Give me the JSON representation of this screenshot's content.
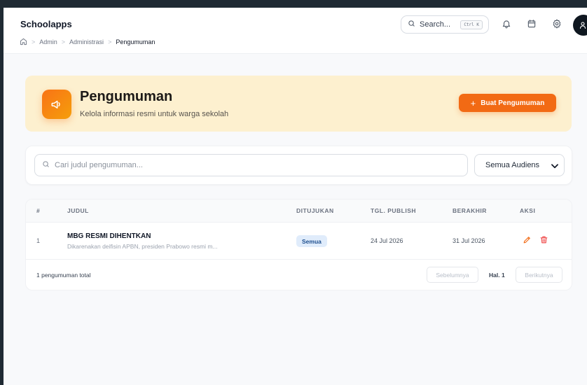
{
  "app": {
    "title": "Schoolapps"
  },
  "breadcrumb": {
    "items": [
      "Admin",
      "Administrasi",
      "Pengumuman"
    ]
  },
  "search": {
    "label": "Search...",
    "shortcut": "Ctrl K"
  },
  "banner": {
    "title": "Pengumuman",
    "subtitle": "Kelola informasi resmi untuk warga sekolah",
    "create_button": "Buat Pengumuman"
  },
  "filter": {
    "placeholder": "Cari judul pengumuman...",
    "audience_selected": "Semua Audiens"
  },
  "table": {
    "headers": {
      "num": "#",
      "title": "JUDUL",
      "target": "DITUJUKAN",
      "publish": "TGL. PUBLISH",
      "end": "BERAKHIR",
      "actions": "AKSI"
    },
    "rows": [
      {
        "num": "1",
        "title": "MBG RESMI DIHENTKAN",
        "desc": "Dikarenakan deifisin APBN, presiden Prabowo resmi m...",
        "target": "Semua",
        "publish": "24 Jul 2026",
        "end": "31 Jul 2026"
      }
    ],
    "total": "1 pengumuman total",
    "pagination": {
      "prev": "Sebelumnya",
      "page": "Hal. 1",
      "next": "Berikutnya"
    }
  },
  "colors": {
    "accent": "#f26a14",
    "banner_bg": "#fdf0cf",
    "badge_bg": "#e0ecfb",
    "delete": "#ef4444"
  },
  "icons": [
    "home-icon",
    "search-icon",
    "bell-icon",
    "calendar-icon",
    "gear-icon",
    "user-icon",
    "megaphone-icon",
    "plus-icon",
    "chevron-down-icon",
    "edit-icon",
    "trash-icon"
  ]
}
